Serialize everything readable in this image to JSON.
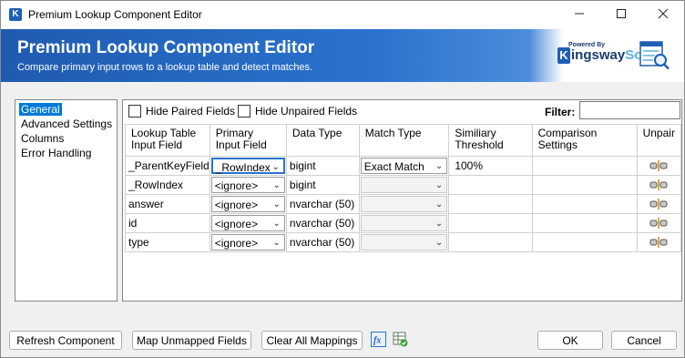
{
  "window": {
    "title": "Premium Lookup Component Editor",
    "controls": [
      "–",
      "☐",
      "✕"
    ]
  },
  "banner": {
    "title": "Premium Lookup Component Editor",
    "subtitle": "Compare primary input rows to a lookup table and detect matches.",
    "logo_small": "Powered By",
    "logo_k": "K",
    "logo_main": "ingsway",
    "logo_soft": "Soft"
  },
  "nav": {
    "items": [
      "General",
      "Advanced Settings",
      "Columns",
      "Error Handling"
    ],
    "selected": "General"
  },
  "toolbar": {
    "hide_paired": "Hide Paired Fields",
    "hide_unpaired": "Hide Unpaired Fields",
    "filter_label": "Filter:",
    "filter_value": ""
  },
  "columns": {
    "lookup": "Lookup Table Input Field",
    "primary": "Primary Input Field",
    "datatype": "Data Type",
    "matchtype": "Match Type",
    "threshold": "Similiary Threshold",
    "comparison": "Comparison Settings",
    "unpair": "Unpair"
  },
  "rows": [
    {
      "lookup": "_ParentKeyField",
      "primary": "_RowIndex",
      "datatype": "bigint",
      "matchtype": "Exact Match",
      "threshold": "100%",
      "comparison": ""
    },
    {
      "lookup": "_RowIndex",
      "primary": "<ignore>",
      "datatype": "bigint",
      "matchtype": "",
      "threshold": "",
      "comparison": ""
    },
    {
      "lookup": "answer",
      "primary": "<ignore>",
      "datatype": "nvarchar (50)",
      "matchtype": "",
      "threshold": "",
      "comparison": ""
    },
    {
      "lookup": "id",
      "primary": "<ignore>",
      "datatype": "nvarchar (50)",
      "matchtype": "",
      "threshold": "",
      "comparison": ""
    },
    {
      "lookup": "type",
      "primary": "<ignore>",
      "datatype": "nvarchar (50)",
      "matchtype": "",
      "threshold": "",
      "comparison": ""
    }
  ],
  "buttons": {
    "refresh": "Refresh Component",
    "map_unmapped": "Map Unmapped Fields",
    "clear_all": "Clear All Mappings",
    "ok": "OK",
    "cancel": "Cancel"
  },
  "colors": {
    "accent": "#0078d7",
    "banner": "#2a73cf"
  }
}
